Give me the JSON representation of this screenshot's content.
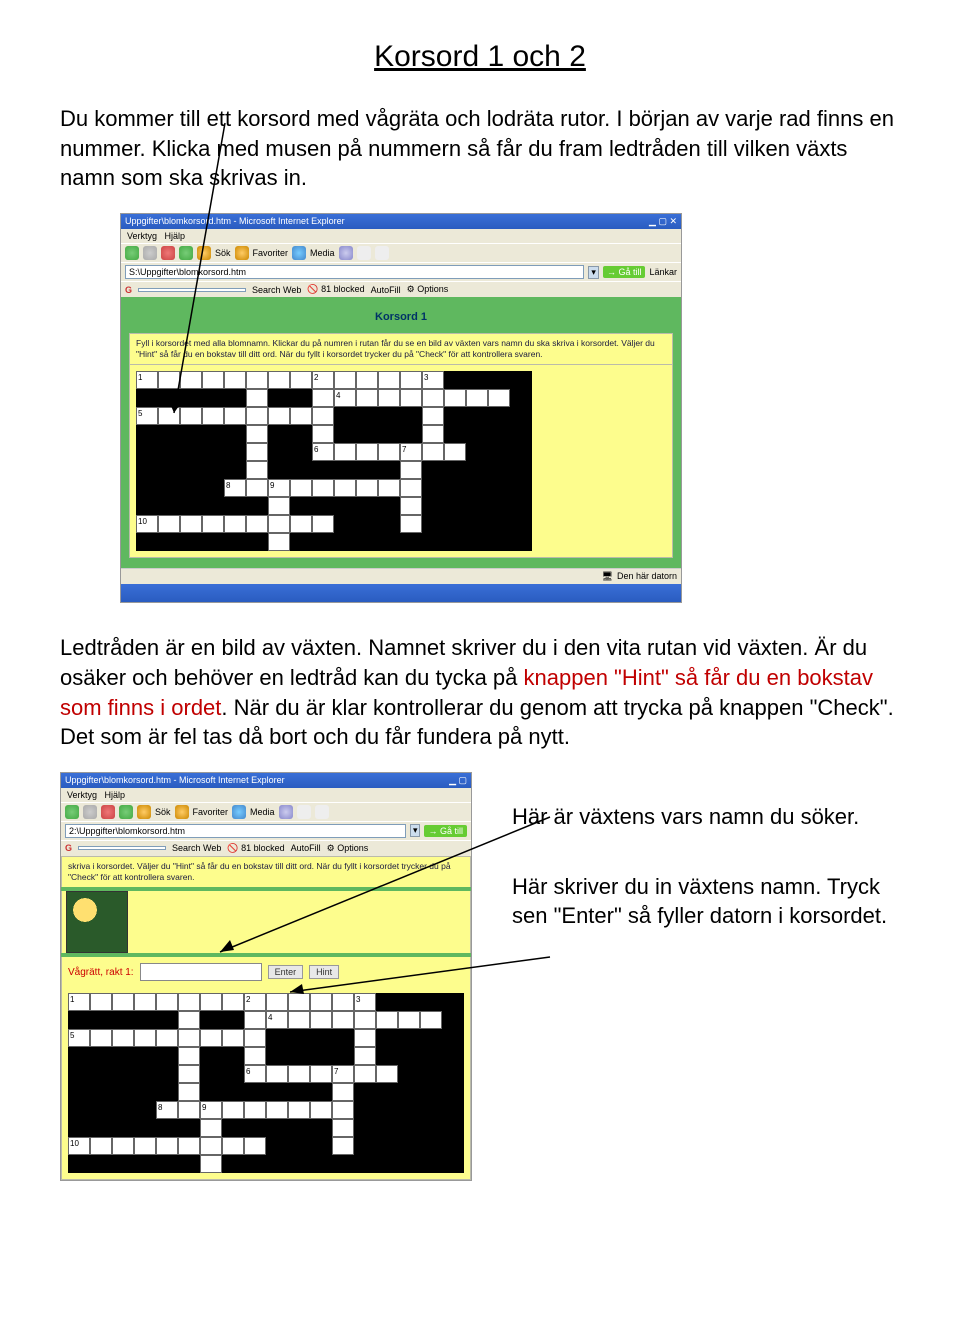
{
  "title": "Korsord 1 och 2",
  "intro": "Du kommer till ett korsord med vågräta och lodräta rutor. I början av varje rad finns en nummer. Klicka med musen på nummern så får du fram ledtråden till vilken växts namn som ska skrivas in.",
  "mid_p1": "Ledtråden är en bild av växten. Namnet skriver du i den vita rutan vid växten. Är du osäker och behöver en ledtråd  kan du tycka på ",
  "mid_red1": "knappen \"Hint\" så får du en bokstav som finns i ordet",
  "mid_p2": ". När du är klar kontrollerar du genom att trycka på knappen \"Check\". Det som är fel tas då bort och du får fundera på nytt.",
  "side1": "Här är växtens vars namn du söker.",
  "side2": "Här skriver du in växtens namn. Tryck sen \"Enter\" så fyller datorn i korsordet.",
  "browser": {
    "title": "Uppgifter\\blomkorsord.htm - Microsoft Internet Explorer",
    "menu_verktyg": "Verktyg",
    "menu_hjalp": "Hjälp",
    "tb_sok": "Sök",
    "tb_fav": "Favoriter",
    "tb_media": "Media",
    "addr": "S:\\Uppgifter\\blomkorsord.htm",
    "go": "Gå till",
    "links": "Länkar",
    "search_web": "Search Web",
    "blocked": "81 blocked",
    "autofill": "AutoFill",
    "options": "Options",
    "korsord_title": "Korsord 1",
    "instructions": "Fyll i korsordet med alla blomnamn. Klickar du på numren i rutan får du se en bild av växten vars namn du ska skriva i korsordet. Väljer du \"Hint\" så får du en bokstav till ditt ord. När du fyllt i korsordet trycker du på \"Check\" för att kontrollera svaren.",
    "status": "Den här datorn"
  },
  "browser2": {
    "title": "Uppgifter\\blomkorsord.htm - Microsoft Internet Explorer",
    "addr": "2:\\Uppgifter\\blomkorsord.htm",
    "instructions": "skriva i korsordet. Väljer du \"Hint\" så får du en bokstav till ditt ord. När du fyllt i korsordet trycker du på \"Check\" för att kontrollera svaren.",
    "clue_label": "Vågrätt, rakt 1:",
    "enter": "Enter",
    "hint": "Hint"
  },
  "numbers": {
    "n1": "1",
    "n2": "2",
    "n3": "3",
    "n4": "4",
    "n5": "5",
    "n6": "6",
    "n7": "7",
    "n8": "8",
    "n9": "9",
    "n10": "10"
  }
}
